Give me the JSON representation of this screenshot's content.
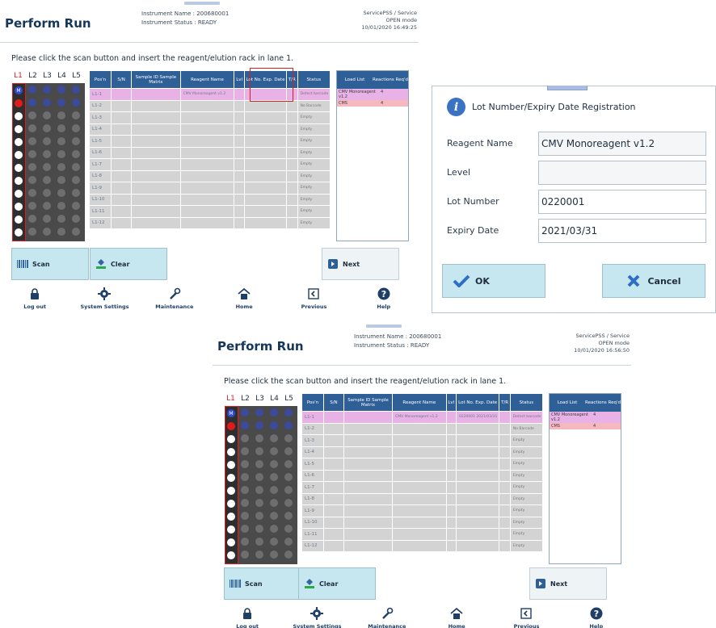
{
  "screen_a": {
    "title": "Perform Run",
    "instrument_name": "Instrument Name :  200680001",
    "instrument_status": "Instrument Status :  READY",
    "service_user": "ServicePSS / Service",
    "mode": "OPEN mode",
    "datetime": "10/01/2020 16:49:25",
    "instruction": "Please click the scan button and insert the reagent/elution rack in lane 1.",
    "rows": [
      {
        "pos": "L1-1",
        "reagent": "CMV Monoreagent v1.2",
        "lot": "",
        "status": "Detect barcode"
      },
      {
        "pos": "L1-2",
        "reagent": "",
        "lot": "",
        "status": "No Barcode"
      },
      {
        "pos": "L1-3",
        "reagent": "",
        "lot": "",
        "status": "Empty"
      },
      {
        "pos": "L1-4",
        "reagent": "",
        "lot": "",
        "status": "Empty"
      },
      {
        "pos": "L1-5",
        "reagent": "",
        "lot": "",
        "status": "Empty"
      },
      {
        "pos": "L1-6",
        "reagent": "",
        "lot": "",
        "status": "Empty"
      },
      {
        "pos": "L1-7",
        "reagent": "",
        "lot": "",
        "status": "Empty"
      },
      {
        "pos": "L1-8",
        "reagent": "",
        "lot": "",
        "status": "Empty"
      },
      {
        "pos": "L1-9",
        "reagent": "",
        "lot": "",
        "status": "Empty"
      },
      {
        "pos": "L1-10",
        "reagent": "",
        "lot": "",
        "status": "Empty"
      },
      {
        "pos": "L1-11",
        "reagent": "",
        "lot": "",
        "status": "Empty"
      },
      {
        "pos": "L1-12",
        "reagent": "",
        "lot": "",
        "status": "Empty"
      }
    ]
  },
  "screen_b": {
    "title": "Perform Run",
    "instrument_name": "Instrument Name :  200680001",
    "instrument_status": "Instrument Status :  READY",
    "service_user": "ServicePSS / Service",
    "mode": "OPEN mode",
    "datetime": "10/01/2020 16:56:50",
    "instruction": "Please click the scan button and insert the reagent/elution rack in lane 1.",
    "rows": [
      {
        "pos": "L1-1",
        "reagent": "CMV Monoreagent v1.2",
        "lot": "0220001 2021/03/31",
        "status": "Detect barcode"
      },
      {
        "pos": "L1-2",
        "reagent": "",
        "lot": "",
        "status": "No Barcode"
      },
      {
        "pos": "L1-3",
        "reagent": "",
        "lot": "",
        "status": "Empty"
      },
      {
        "pos": "L1-4",
        "reagent": "",
        "lot": "",
        "status": "Empty"
      },
      {
        "pos": "L1-5",
        "reagent": "",
        "lot": "",
        "status": "Empty"
      },
      {
        "pos": "L1-6",
        "reagent": "",
        "lot": "",
        "status": "Empty"
      },
      {
        "pos": "L1-7",
        "reagent": "",
        "lot": "",
        "status": "Empty"
      },
      {
        "pos": "L1-8",
        "reagent": "",
        "lot": "",
        "status": "Empty"
      },
      {
        "pos": "L1-9",
        "reagent": "",
        "lot": "",
        "status": "Empty"
      },
      {
        "pos": "L1-10",
        "reagent": "",
        "lot": "",
        "status": "Empty"
      },
      {
        "pos": "L1-11",
        "reagent": "",
        "lot": "",
        "status": "Empty"
      },
      {
        "pos": "L1-12",
        "reagent": "",
        "lot": "",
        "status": "Empty"
      }
    ]
  },
  "common": {
    "lanes": [
      "L1",
      "L2",
      "L3",
      "L4",
      "L5"
    ],
    "tube_marker": "M",
    "columns": {
      "pos": "Pos'n",
      "sn": "S/N",
      "sample": "Sample ID Sample Matrix",
      "reagent": "Reagent Name",
      "lvl": "Lvl",
      "lot": "Lot No. Exp. Date",
      "tr": "T/R",
      "status": "Status"
    },
    "load_list": {
      "col_name": "Load List",
      "col_reactions": "Reactions Req'd",
      "items": [
        {
          "name": "CMV Monoreagent v1.2",
          "reactions": "4"
        },
        {
          "name": "CMS",
          "reactions": "4"
        }
      ]
    },
    "buttons": {
      "scan": "Scan",
      "clear": "Clear",
      "next": "Next"
    },
    "toolbar": [
      {
        "label": "Log out",
        "icon": "lock-icon"
      },
      {
        "label": "System Settings",
        "icon": "gear-icon"
      },
      {
        "label": "Maintenance",
        "icon": "wrench-icon"
      },
      {
        "label": "Home",
        "icon": "home-icon"
      },
      {
        "label": "Previous",
        "icon": "previous-icon"
      },
      {
        "label": "Help",
        "icon": "help-icon"
      }
    ],
    "colors": {
      "header_blue": "#2f5f97",
      "highlight_row": "#e8b2e6",
      "button_teal": "#c6e7ef",
      "selection_red": "#e01b1b"
    }
  },
  "dialog": {
    "title": "Lot Number/Expiry Date Registration",
    "icon": "info-icon",
    "fields": [
      {
        "label": "Reagent Name",
        "value": "CMV Monoreagent v1.2"
      },
      {
        "label": "Level",
        "value": ""
      },
      {
        "label": "Lot Number",
        "value": "0220001"
      },
      {
        "label": "Expiry Date",
        "value": "2021/03/31"
      }
    ],
    "ok_label": "OK",
    "cancel_label": "Cancel"
  }
}
